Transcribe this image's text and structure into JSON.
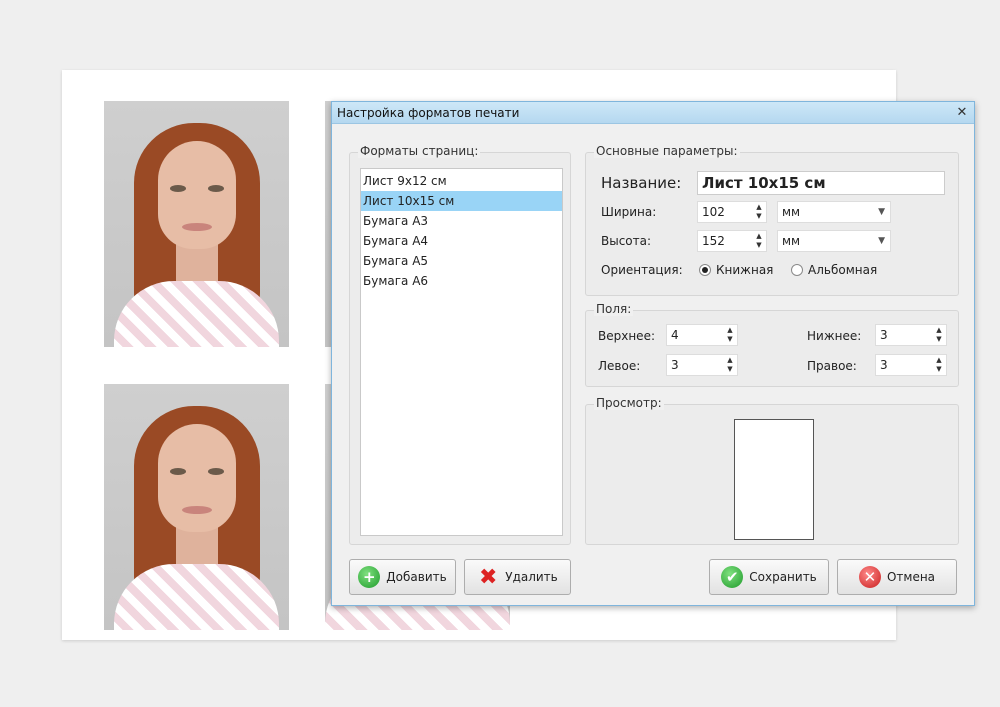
{
  "dialog": {
    "title": "Настройка форматов печати",
    "close_glyph": "✕"
  },
  "formats": {
    "legend": "Форматы страниц:",
    "items": [
      "Лист 9x12 см",
      "Лист 10x15 см",
      "Бумага А3",
      "Бумага А4",
      "Бумага А5",
      "Бумага А6"
    ],
    "selected_index": 1
  },
  "basic": {
    "legend": "Основные параметры:",
    "name_label": "Название:",
    "name_value": "Лист 10x15 см",
    "width_label": "Ширина:",
    "width_value": "102",
    "width_unit": "мм",
    "height_label": "Высота:",
    "height_value": "152",
    "height_unit": "мм",
    "orientation_label": "Ориентация:",
    "portrait_label": "Книжная",
    "landscape_label": "Альбомная",
    "orientation_selected": "portrait"
  },
  "margins": {
    "legend": "Поля:",
    "top_label": "Верхнее:",
    "top_value": "4",
    "bottom_label": "Нижнее:",
    "bottom_value": "3",
    "left_label": "Левое:",
    "left_value": "3",
    "right_label": "Правое:",
    "right_value": "3"
  },
  "preview": {
    "legend": "Просмотр:"
  },
  "buttons": {
    "add": "Добавить",
    "delete": "Удалить",
    "save": "Сохранить",
    "cancel": "Отмена"
  },
  "icons": {
    "add": "plus-circle-icon",
    "delete": "red-x-icon",
    "save": "checkmark-circle-icon",
    "cancel": "cancel-circle-icon"
  }
}
